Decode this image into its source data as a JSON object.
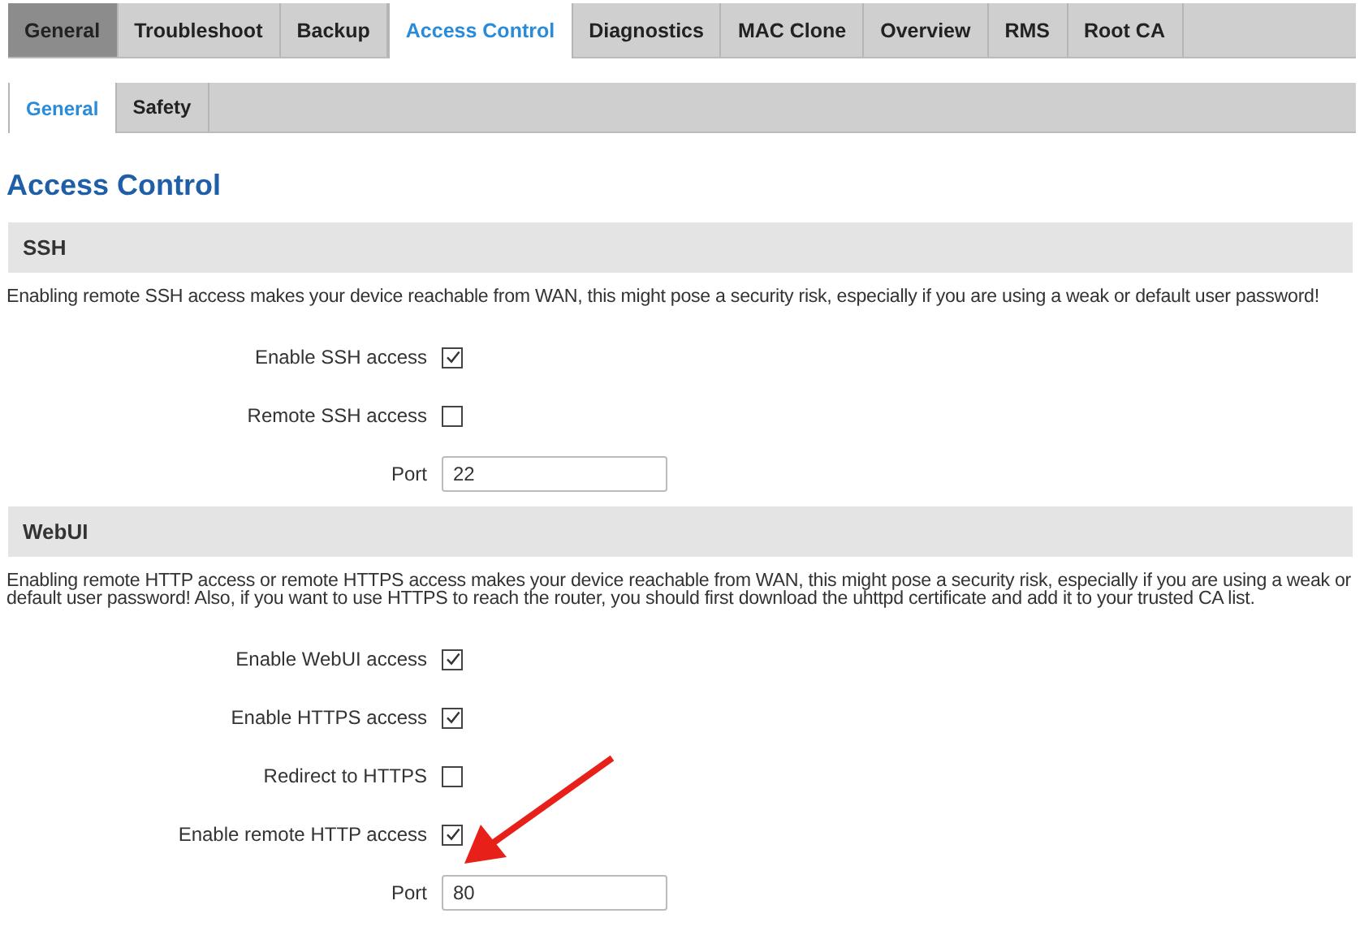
{
  "tabs": [
    {
      "label": "General",
      "selected": false,
      "hovered": true
    },
    {
      "label": "Troubleshoot",
      "selected": false,
      "hovered": false
    },
    {
      "label": "Backup",
      "selected": false,
      "hovered": false
    },
    {
      "label": "Access Control",
      "selected": true,
      "hovered": false
    },
    {
      "label": "Diagnostics",
      "selected": false,
      "hovered": false
    },
    {
      "label": "MAC Clone",
      "selected": false,
      "hovered": false
    },
    {
      "label": "Overview",
      "selected": false,
      "hovered": false
    },
    {
      "label": "RMS",
      "selected": false,
      "hovered": false
    },
    {
      "label": "Root CA",
      "selected": false,
      "hovered": false
    }
  ],
  "subtabs": [
    {
      "label": "General",
      "selected": true
    },
    {
      "label": "Safety",
      "selected": false
    }
  ],
  "title": "Access Control",
  "sections": [
    {
      "heading": "SSH",
      "description": "Enabling remote SSH access makes your device reachable from WAN, this might pose a security risk, especially if you are using a weak or default user password!",
      "fields": [
        {
          "kind": "checkbox",
          "label": "Enable SSH access",
          "checked": true,
          "annotated": false
        },
        {
          "kind": "checkbox",
          "label": "Remote SSH access",
          "checked": false,
          "annotated": false
        },
        {
          "kind": "text",
          "label": "Port",
          "value": "22"
        }
      ]
    },
    {
      "heading": "WebUI",
      "description": "Enabling remote HTTP access or remote HTTPS access makes your device reachable from WAN, this might pose a security risk, especially if you are using a weak or default user password! Also, if you want to use HTTPS to reach the router, you should first download the uhttpd certificate and add it to your trusted CA list.",
      "fields": [
        {
          "kind": "checkbox",
          "label": "Enable WebUI access",
          "checked": true,
          "annotated": false
        },
        {
          "kind": "checkbox",
          "label": "Enable HTTPS access",
          "checked": true,
          "annotated": false
        },
        {
          "kind": "checkbox",
          "label": "Redirect to HTTPS",
          "checked": false,
          "annotated": false
        },
        {
          "kind": "checkbox",
          "label": "Enable remote HTTP access",
          "checked": true,
          "annotated": true
        },
        {
          "kind": "text",
          "label": "Port",
          "value": "80"
        }
      ]
    }
  ]
}
